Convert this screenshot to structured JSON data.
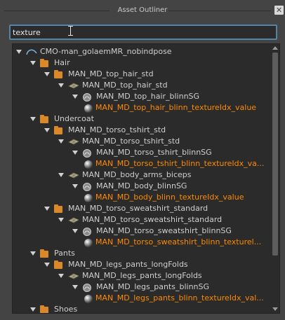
{
  "window": {
    "title": "Asset Outliner",
    "close_label": "✕"
  },
  "search": {
    "value": "texture",
    "placeholder": ""
  },
  "tree": [
    {
      "depth": 0,
      "icon": "curve-icon",
      "label": "CMO-man_golaemMR_nobindpose",
      "highlight": false
    },
    {
      "depth": 1,
      "icon": "folder-icon",
      "label": "Hair",
      "highlight": false
    },
    {
      "depth": 2,
      "icon": "folder-icon",
      "label": "MAN_MD_top_hair_std",
      "highlight": false
    },
    {
      "depth": 3,
      "icon": "mesh-icon",
      "label": "MAN_MD_top_hair_std",
      "highlight": false
    },
    {
      "depth": 4,
      "icon": "shading-group-icon",
      "label": "MAN_MD_top_hair_blinnSG",
      "highlight": false
    },
    {
      "depth": 5,
      "icon": "shader-node-icon",
      "label": "MAN_MD_top_hair_blinn_textureIdx_value",
      "highlight": true
    },
    {
      "depth": 1,
      "icon": "folder-icon",
      "label": "Undercoat",
      "highlight": false
    },
    {
      "depth": 2,
      "icon": "folder-icon",
      "label": "MAN_MD_torso_tshirt_std",
      "highlight": false
    },
    {
      "depth": 3,
      "icon": "mesh-icon",
      "label": "MAN_MD_torso_tshirt_std",
      "highlight": false
    },
    {
      "depth": 4,
      "icon": "shading-group-icon",
      "label": "MAN_MD_torso_tshirt_blinnSG",
      "highlight": false
    },
    {
      "depth": 5,
      "icon": "shader-node-icon",
      "label": "MAN_MD_torso_tshirt_blinn_textureIdx_va...",
      "highlight": true
    },
    {
      "depth": 3,
      "icon": "mesh-icon",
      "label": "MAN_MD_body_arms_biceps",
      "highlight": false
    },
    {
      "depth": 4,
      "icon": "shading-group-icon",
      "label": "MAN_MD_body_blinnSG",
      "highlight": false
    },
    {
      "depth": 5,
      "icon": "shader-node-icon",
      "label": "MAN_MD_body_blinn_textureIdx_value",
      "highlight": true
    },
    {
      "depth": 2,
      "icon": "folder-icon",
      "label": "MAN_MD_torso_sweatshirt_standard",
      "highlight": false
    },
    {
      "depth": 3,
      "icon": "mesh-icon",
      "label": "MAN_MD_torso_sweatshirt_standard",
      "highlight": false
    },
    {
      "depth": 4,
      "icon": "shading-group-icon",
      "label": "MAN_MD_torso_sweatshirt_blinnSG",
      "highlight": false
    },
    {
      "depth": 5,
      "icon": "shader-node-icon",
      "label": "MAN_MD_torso_sweatshirt_blinn_texturel...",
      "highlight": true
    },
    {
      "depth": 1,
      "icon": "folder-icon",
      "label": "Pants",
      "highlight": false
    },
    {
      "depth": 2,
      "icon": "folder-icon",
      "label": "MAN_MD_legs_pants_longFolds",
      "highlight": false
    },
    {
      "depth": 3,
      "icon": "mesh-icon",
      "label": "MAN_MD_legs_pants_longFolds",
      "highlight": false
    },
    {
      "depth": 4,
      "icon": "shading-group-icon",
      "label": "MAN_MD_legs_pants_blinnSG",
      "highlight": false
    },
    {
      "depth": 5,
      "icon": "shader-node-icon",
      "label": "MAN_MD_legs_pants_blinn_textureIdx_val...",
      "highlight": true
    },
    {
      "depth": 1,
      "icon": "folder-icon",
      "label": "Shoes",
      "highlight": false
    }
  ],
  "colors": {
    "highlight": "#ff8a00",
    "folder": "#d9882a",
    "accent": "#5285a6"
  }
}
